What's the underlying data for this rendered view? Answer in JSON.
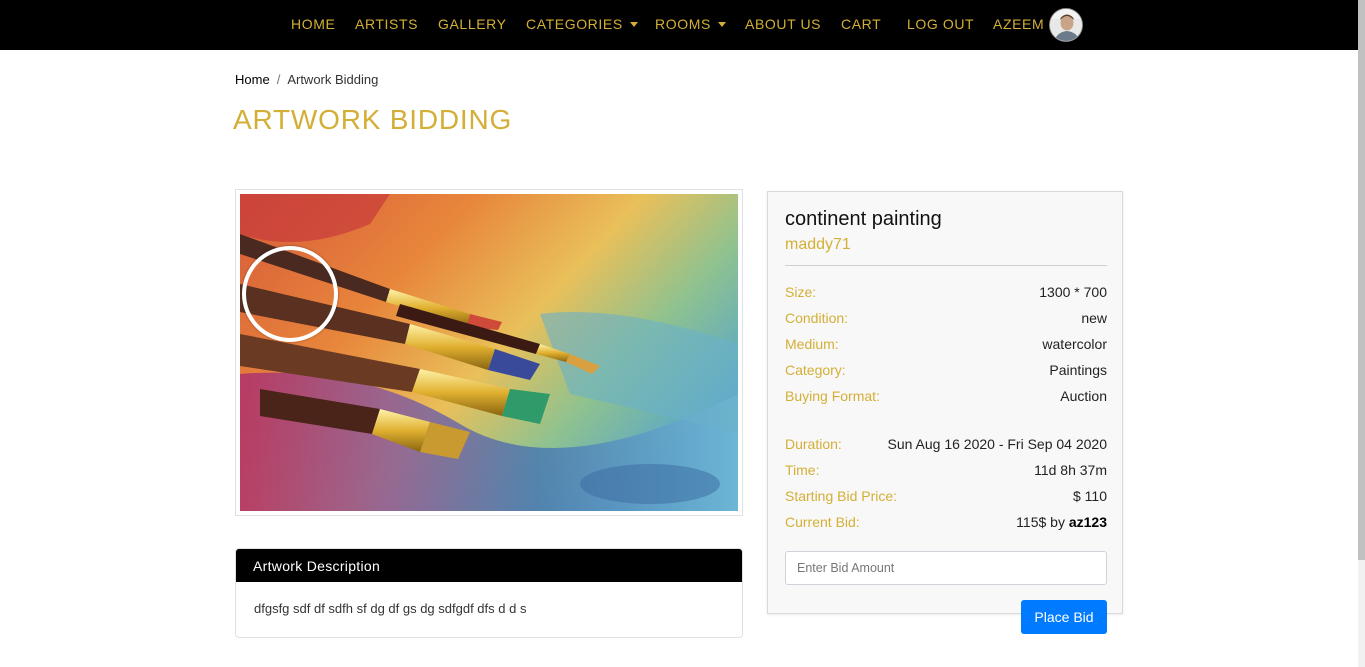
{
  "nav": {
    "items": [
      {
        "label": "HOME"
      },
      {
        "label": "ARTISTS"
      },
      {
        "label": "GALLERY"
      },
      {
        "label": "CATEGORIES"
      },
      {
        "label": "ROOMS"
      },
      {
        "label": "ABOUT US"
      },
      {
        "label": "CART"
      },
      {
        "label": "LOG OUT"
      },
      {
        "label": "AZEEM"
      }
    ]
  },
  "breadcrumb": {
    "home": "Home",
    "separator": "/",
    "current": "Artwork Bidding"
  },
  "page_title": "ARTWORK BIDDING",
  "artwork": {
    "title": "continent painting",
    "artist": "maddy71",
    "details": [
      {
        "label": "Size:",
        "value": "1300 * 700"
      },
      {
        "label": "Condition:",
        "value": "new"
      },
      {
        "label": "Medium:",
        "value": "watercolor"
      },
      {
        "label": "Category:",
        "value": "Paintings"
      },
      {
        "label": "Buying Format:",
        "value": "Auction"
      }
    ],
    "auction": [
      {
        "label": "Duration:",
        "value": "Sun Aug 16 2020 - Fri Sep 04 2020"
      },
      {
        "label": "Time:",
        "value": "11d 8h 37m"
      },
      {
        "label": "Starting Bid Price:",
        "value": "$ 110"
      }
    ],
    "current_bid": {
      "label": "Current Bid:",
      "amount": "115$ by ",
      "bidder": "az123"
    }
  },
  "bid": {
    "placeholder": "Enter Bid Amount",
    "button_label": "Place Bid"
  },
  "description": {
    "header": "Artwork Description",
    "text": "dfgsfg sdf df sdfh sf dg df gs dg sdfgdf dfs d d s"
  },
  "colors": {
    "accent": "#d4af37",
    "navbar": "#000000",
    "button": "#007bff"
  }
}
